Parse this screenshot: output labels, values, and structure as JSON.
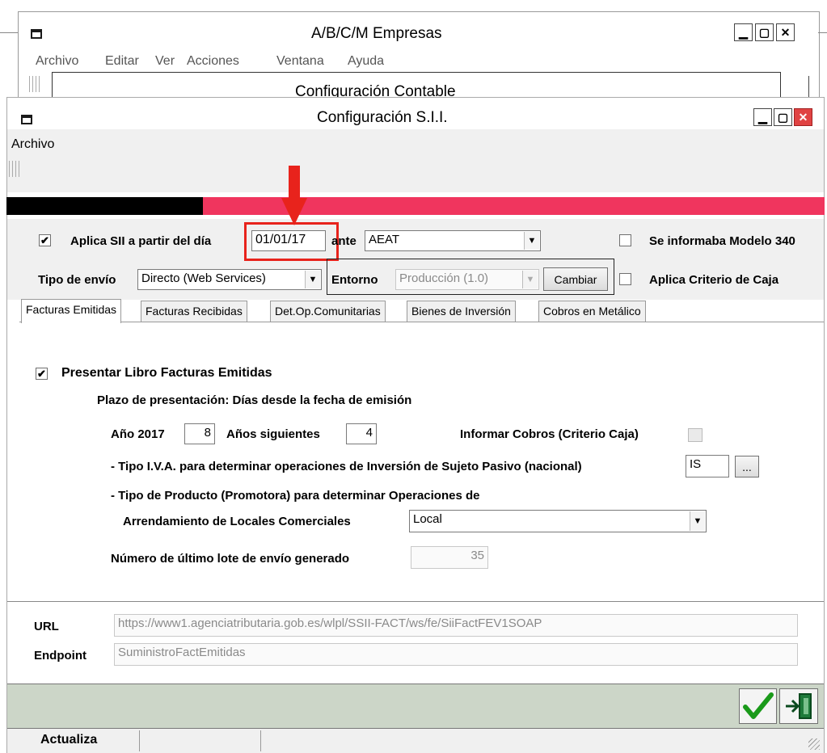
{
  "back_window": {
    "title": "A/B/C/M Empresas",
    "menu": [
      "Archivo",
      "Editar",
      "Ver",
      "Acciones",
      "Ventana",
      "Ayuda"
    ],
    "inner_title": "Configuración Contable"
  },
  "window": {
    "title": "Configuración S.I.I.",
    "menu": [
      "Archivo"
    ]
  },
  "header": {
    "aplica_sii_label": "Aplica SII a partir del día",
    "aplica_sii_checked": true,
    "date_value": "01/01/17",
    "ante_label": "ante",
    "ante_value": "AEAT",
    "modelo340_label": "Se informaba Modelo 340",
    "modelo340_checked": false,
    "tipo_envio_label": "Tipo de envío",
    "tipo_envio_value": "Directo (Web Services)",
    "entorno_label": "Entorno",
    "entorno_value": "Producción (1.0)",
    "cambiar_label": "Cambiar",
    "criterio_caja_label": "Aplica Criterio de Caja",
    "criterio_caja_checked": false
  },
  "tabs": [
    {
      "label": "Facturas Emitidas",
      "active": true
    },
    {
      "label": "Facturas Recibidas",
      "active": false
    },
    {
      "label": "Det.Op.Comunitarias",
      "active": false
    },
    {
      "label": "Bienes de Inversión",
      "active": false
    },
    {
      "label": "Cobros en Metálico",
      "active": false
    }
  ],
  "panel": {
    "presentar_label": "Presentar Libro Facturas Emitidas",
    "presentar_checked": true,
    "plazo_label": "Plazo de presentación: Días desde la fecha de emisión",
    "anio_label": "Año 2017",
    "anio_value": "8",
    "siguientes_label": "Años siguientes",
    "siguientes_value": "4",
    "informar_cobros_label": "Informar Cobros (Criterio Caja)",
    "tipo_iva_label": "- Tipo I.V.A. para determinar operaciones de Inversión de Sujeto Pasivo (nacional)",
    "tipo_iva_value": "IS",
    "ellipsis_label": "...",
    "tipo_producto_label": "- Tipo de Producto (Promotora) para determinar Operaciones de",
    "arrendamiento_label": "Arrendamiento de Locales Comerciales",
    "arrendamiento_value": "Local",
    "lote_label": "Número de último lote de envío generado",
    "lote_value": "35"
  },
  "endpoint": {
    "url_label": "URL",
    "url_value": "https://www1.agenciatributaria.gob.es/wlpl/SSII-FACT/ws/fe/SiiFactFEV1SOAP",
    "endpoint_label": "Endpoint",
    "endpoint_value": "SuministroFactEmitidas"
  },
  "status": {
    "text": "Actualiza"
  },
  "colors": {
    "progress_fill": "#000000",
    "progress_track": "#f0355e",
    "annotation": "#e8231c",
    "footer_bg": "#ccd6c8",
    "confirm_check": "#1a9a1a"
  }
}
